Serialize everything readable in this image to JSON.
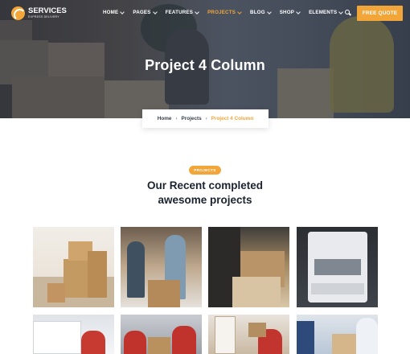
{
  "header": {
    "logo_name": "SERVICES",
    "logo_tagline": "EXPRESS DELIVERY",
    "nav": [
      {
        "label": "HOME",
        "has_caret": true,
        "active": false
      },
      {
        "label": "PAGES",
        "has_caret": true,
        "active": false
      },
      {
        "label": "FEATURES",
        "has_caret": true,
        "active": false
      },
      {
        "label": "PROJECTS",
        "has_caret": true,
        "active": true
      },
      {
        "label": "BLOG",
        "has_caret": true,
        "active": false
      },
      {
        "label": "SHOP",
        "has_caret": true,
        "active": false
      },
      {
        "label": "ELEMENTS",
        "has_caret": true,
        "active": false
      }
    ],
    "search_icon": "search-icon",
    "cta_label": "FREE QUOTE"
  },
  "hero": {
    "title": "Project 4 Column"
  },
  "breadcrumb": {
    "items": [
      "Home",
      "Projects",
      "Project 4 Column"
    ],
    "separator": "›"
  },
  "section": {
    "badge": "PROJECTS",
    "title_line1": "Our Recent completed",
    "title_line2": "awesome projects"
  },
  "projects": [
    {
      "image": "stacked-cardboard-boxes-photo"
    },
    {
      "image": "warehouse-workers-packing-photo"
    },
    {
      "image": "man-holding-box-photo"
    },
    {
      "image": "delivery-truck-photo"
    },
    {
      "image": "van-driver-photo"
    },
    {
      "image": "couriers-at-van-photo"
    },
    {
      "image": "courier-at-door-photo"
    },
    {
      "image": "package-handover-photo"
    }
  ],
  "colors": {
    "accent": "#f2a63a",
    "hero_overlay": "#182234",
    "heading": "#1c2330",
    "nav_text": "#ffffff"
  }
}
